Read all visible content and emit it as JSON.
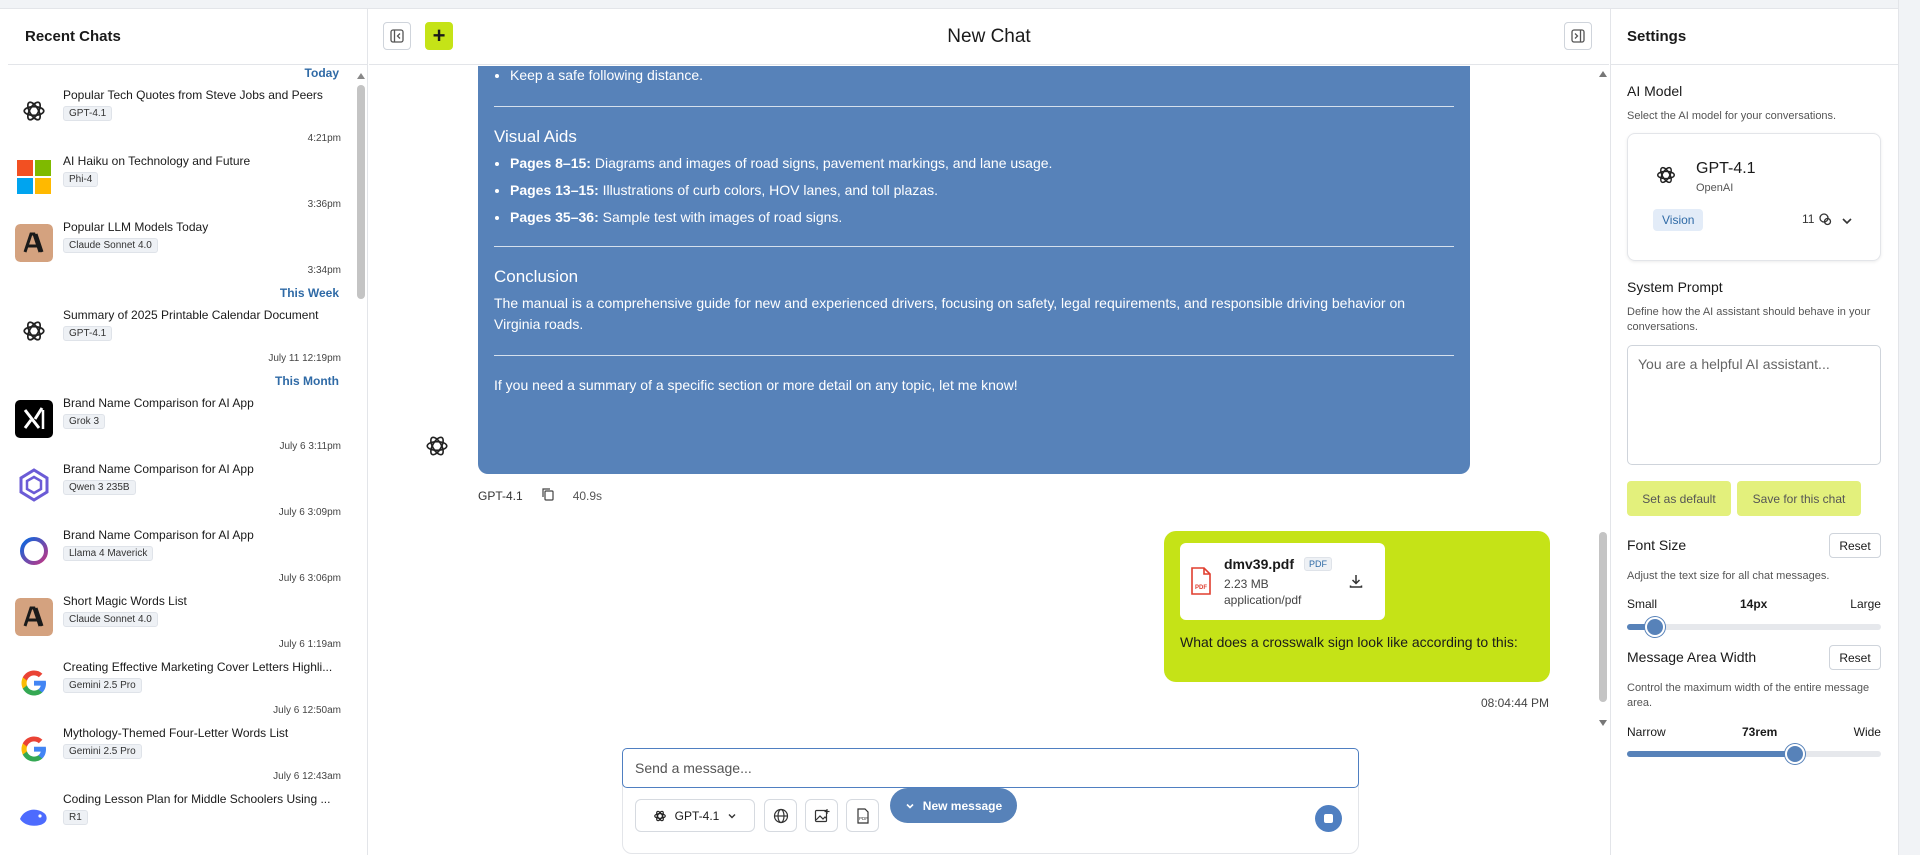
{
  "sidebar": {
    "title": "Recent Chats",
    "sections": [
      {
        "label": "Today",
        "items": [
          {
            "title": "Popular Tech Quotes from Steve Jobs and Peers",
            "model": "GPT-4.1",
            "time": "4:21pm",
            "icon": "openai-icon"
          },
          {
            "title": "AI Haiku on Technology and Future",
            "model": "Phi-4",
            "time": "3:36pm",
            "icon": "microsoft-icon"
          },
          {
            "title": "Popular LLM Models Today",
            "model": "Claude Sonnet 4.0",
            "time": "3:34pm",
            "icon": "anthropic-icon"
          }
        ]
      },
      {
        "label": "This Week",
        "items": [
          {
            "title": "Summary of 2025 Printable Calendar Document",
            "model": "GPT-4.1",
            "time": "July 11 12:19pm",
            "icon": "openai-icon"
          }
        ]
      },
      {
        "label": "This Month",
        "items": [
          {
            "title": "Brand Name Comparison for AI App",
            "model": "Grok 3",
            "time": "July 6 3:11pm",
            "icon": "xai-icon"
          },
          {
            "title": "Brand Name Comparison for AI App",
            "model": "Qwen 3 235B",
            "time": "July 6 3:09pm",
            "icon": "qwen-icon"
          },
          {
            "title": "Brand Name Comparison for AI App",
            "model": "Llama 4 Maverick",
            "time": "July 6 3:06pm",
            "icon": "meta-icon"
          },
          {
            "title": "Short Magic Words List",
            "model": "Claude Sonnet 4.0",
            "time": "July 6 1:19am",
            "icon": "anthropic-icon"
          },
          {
            "title": "Creating Effective Marketing Cover Letters Highli...",
            "model": "Gemini 2.5 Pro",
            "time": "July 6 12:50am",
            "icon": "google-icon"
          },
          {
            "title": "Mythology-Themed Four-Letter Words List",
            "model": "Gemini 2.5 Pro",
            "time": "July 6 12:43am",
            "icon": "google-icon"
          },
          {
            "title": "Coding Lesson Plan for Middle Schoolers Using ...",
            "model": "R1",
            "time": "",
            "icon": "deepseek-icon"
          }
        ]
      }
    ]
  },
  "header": {
    "title": "New Chat"
  },
  "ai_message": {
    "bullet_top": "Keep a safe following distance.",
    "visual_aids_heading": "Visual Aids",
    "visual_aids": [
      {
        "bold": "Pages 8–15:",
        "text": " Diagrams and images of road signs, pavement markings, and lane usage."
      },
      {
        "bold": "Pages 13–15:",
        "text": " Illustrations of curb colors, HOV lanes, and toll plazas."
      },
      {
        "bold": "Pages 35–36:",
        "text": " Sample test with images of road signs."
      }
    ],
    "conclusion_heading": "Conclusion",
    "conclusion": "The manual is a comprehensive guide for new and experienced drivers, focusing on safety, legal requirements, and responsible driving behavior on Virginia roads.",
    "closing": "If you need a summary of a specific section or more detail on any topic, let me know!",
    "model": "GPT-4.1",
    "duration": "40.9s"
  },
  "user_message": {
    "file_name": "dmv39.pdf",
    "file_type": "PDF",
    "file_size": "2.23 MB",
    "file_mime": "application/pdf",
    "text": "What does a crosswalk sign look like according to this:",
    "time": "08:04:44 PM"
  },
  "composer": {
    "placeholder": "Send a message...",
    "model": "GPT-4.1",
    "new_message_label": "New message"
  },
  "settings": {
    "title": "Settings",
    "ai_model_title": "AI Model",
    "ai_model_desc": "Select the AI model for your conversations.",
    "model_name": "GPT-4.1",
    "model_provider": "OpenAI",
    "capability_badge": "Vision",
    "context_count": "11",
    "system_prompt_title": "System Prompt",
    "system_prompt_desc": "Define how the AI assistant should behave in your conversations.",
    "system_prompt_placeholder": "You are a helpful AI assistant...",
    "set_default_label": "Set as default",
    "save_chat_label": "Save for this chat",
    "font_size_title": "Font Size",
    "font_size_desc": "Adjust the text size for all chat messages.",
    "font_size_min": "Small",
    "font_size_value": "14px",
    "font_size_max": "Large",
    "font_size_fraction": 0.11,
    "reset_label": "Reset",
    "width_title": "Message Area Width",
    "width_desc": "Control the maximum width of the entire message area.",
    "width_min": "Narrow",
    "width_value": "73rem",
    "width_max": "Wide",
    "width_fraction": 0.66
  },
  "colors": {
    "accent_lime": "#c5e317",
    "accent_blue": "#5782b9"
  }
}
